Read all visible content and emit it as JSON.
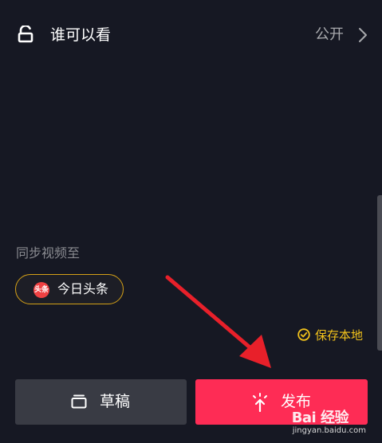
{
  "privacy": {
    "label": "谁可以看",
    "value": "公开"
  },
  "sync": {
    "label": "同步视频至",
    "toutiao_logo_text": "头条",
    "toutiao_label": "今日头条"
  },
  "save_local": {
    "label": "保存本地"
  },
  "actions": {
    "draft_label": "草稿",
    "publish_label": "发布"
  },
  "watermark": {
    "logo_text": "Bai 经验",
    "url": "jingyan.baidu.com"
  },
  "colors": {
    "background": "#161823",
    "accent_publish": "#fe2c55",
    "draft_button": "#393b44",
    "gold": "#f2c21b",
    "annotation_red": "#e8202a"
  },
  "icons": {
    "privacy": "unlock-icon",
    "privacy_chevron": "chevron-right-icon",
    "save": "check-circle-icon",
    "draft": "draft-box-icon",
    "publish": "upload-sparkle-icon"
  }
}
